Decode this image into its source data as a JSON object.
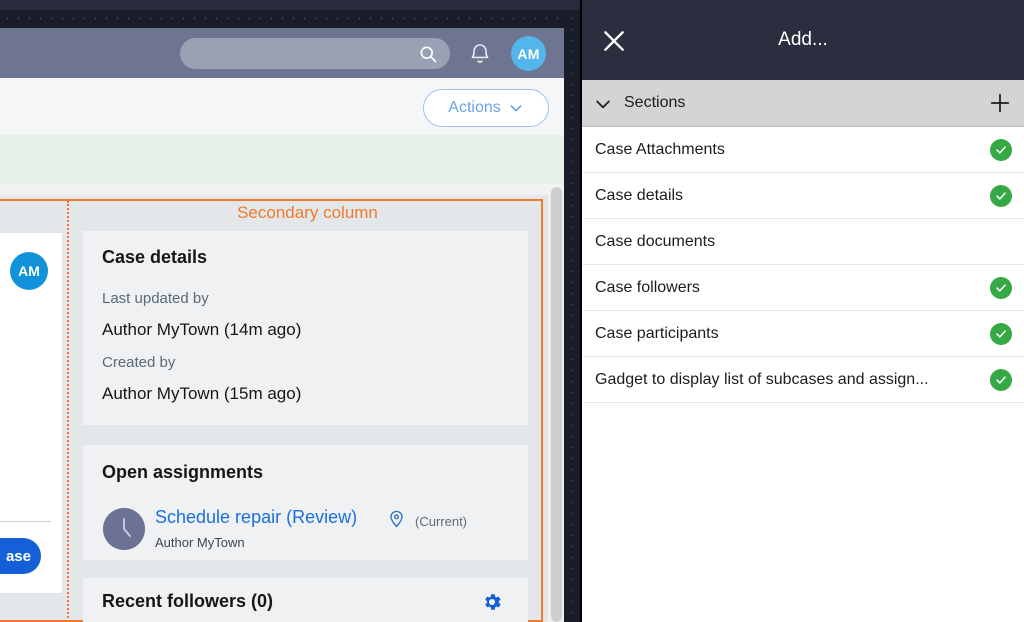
{
  "app": {
    "header": {
      "search_placeholder": "",
      "search_value": "",
      "search_icon": "search-icon",
      "bell_icon": "notification-bell-icon",
      "avatar_initials": "AM"
    },
    "subheader": {
      "actions_label": "Actions",
      "actions_chevron": "chevron-down-icon"
    },
    "left_card": {
      "avatar_initials": "AM",
      "button_label": "ase"
    },
    "secondary_column": {
      "label": "Secondary column",
      "accent_color": "#f1792c",
      "widgets": {
        "case_details": {
          "title": "Case details",
          "fields": [
            {
              "label": "Last updated by",
              "value": "Author MyTown (14m ago)"
            },
            {
              "label": "Created by",
              "value": "Author MyTown (15m ago)"
            }
          ]
        },
        "open_assignments": {
          "title": "Open assignments",
          "assignment_icon": "clock-avatar-icon",
          "assignment_link": "Schedule repair (Review)",
          "pin_icon": "location-pin-icon",
          "assignment_status": "(Current)",
          "assignment_author": "Author MyTown"
        },
        "recent_followers": {
          "title": "Recent followers (0)",
          "gear_icon": "gear-icon"
        }
      }
    }
  },
  "modal": {
    "close_icon": "close-icon",
    "title": "Add...",
    "sections_bar": {
      "chevron_icon": "chevron-down-icon",
      "label": "Sections",
      "plus_icon": "plus-icon"
    },
    "items": [
      {
        "label": "Case Attachments",
        "selected": true
      },
      {
        "label": "Case details",
        "selected": true
      },
      {
        "label": "Case documents",
        "selected": false
      },
      {
        "label": "Case followers",
        "selected": true
      },
      {
        "label": "Case participants",
        "selected": true
      },
      {
        "label": "Gadget to display list of subcases and assign...",
        "selected": true
      }
    ],
    "check_color": "#36a845"
  }
}
